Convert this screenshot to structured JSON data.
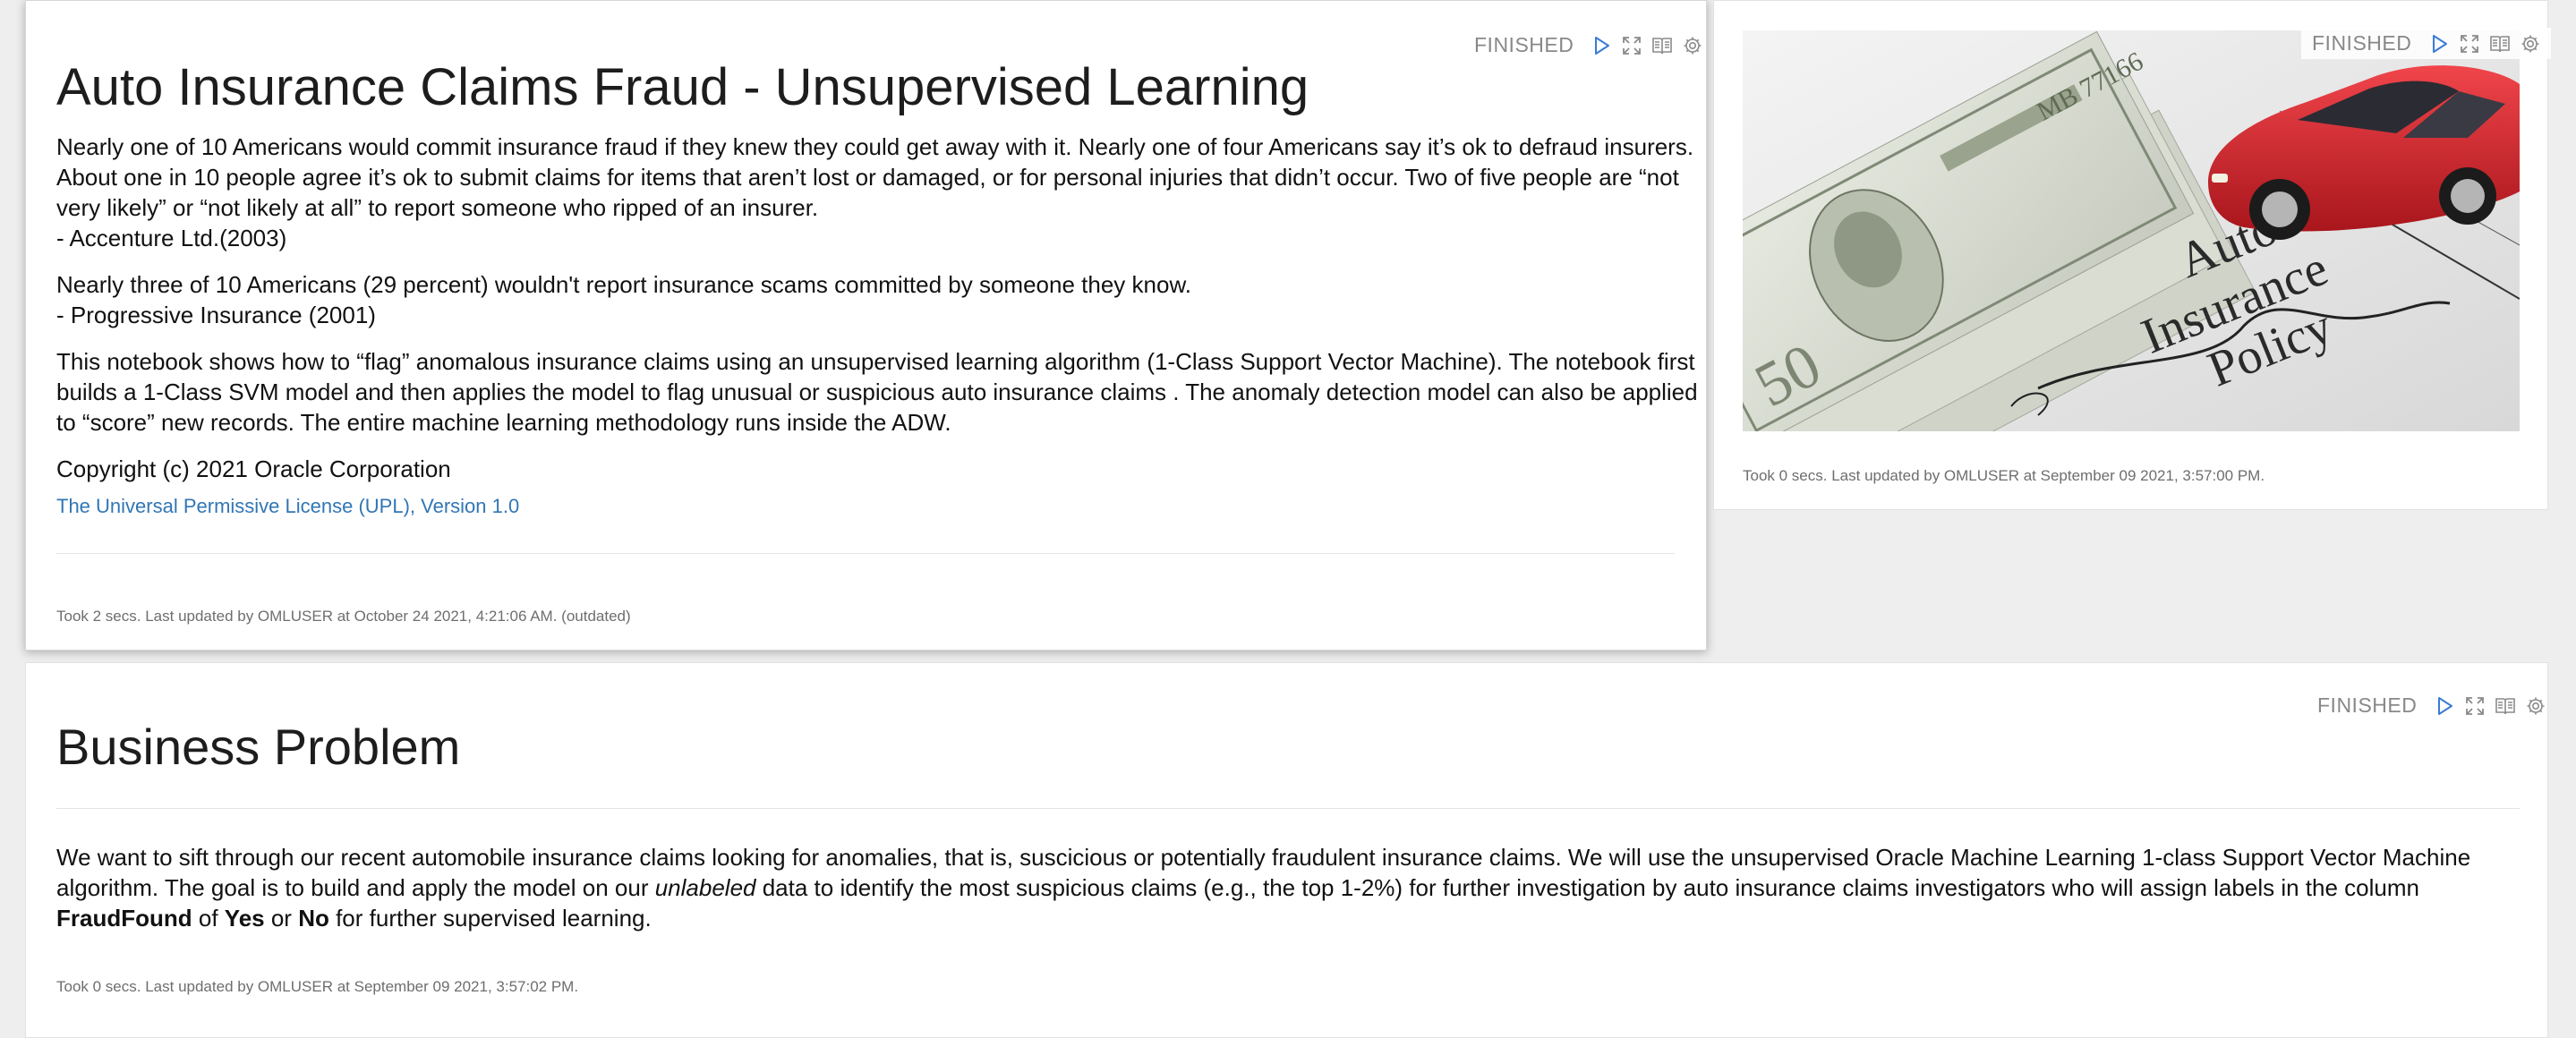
{
  "cells": [
    {
      "status": "FINISHED",
      "title": "Auto Insurance Claims Fraud - Unsupervised Learning",
      "paragraph1": "Nearly one of 10 Americans would commit insurance fraud if they knew they could get away with it. Nearly one of four Americans say it’s ok to defraud insurers. About one in 10 people agree it’s ok to submit claims for items that aren’t lost or damaged, or for personal injuries that didn’t occur. Two of five people are “not very likely” or “not likely at all” to report someone who ripped of an insurer.",
      "source1": "- Accenture Ltd.(2003)",
      "paragraph2": "Nearly three of 10 Americans (29 percent) wouldn't report insurance scams committed by someone they know.",
      "source2": "- Progressive Insurance (2001)",
      "paragraph3": "This notebook shows how to “flag” anomalous insurance claims using an unsupervised learning algorithm (1-Class Support Vector Machine). The notebook first builds a 1-Class SVM model and then applies the model to flag unusual or suspicious auto insurance claims . The anomaly detection model can also be applied to “score” new records. The entire machine learning methodology runs inside the ADW.",
      "copyright": "Copyright (c) 2021 Oracle Corporation",
      "license_link": "The Universal Permissive License (UPL), Version 1.0",
      "footer": "Took 2 secs. Last updated by OMLUSER at October 24 2021, 4:21:06 AM. (outdated)"
    },
    {
      "status": "FINISHED",
      "image_text": [
        "Auto",
        "Insurance",
        "Policy"
      ],
      "footer": "Took 0 secs. Last updated by OMLUSER at September 09 2021, 3:57:00 PM."
    },
    {
      "status": "FINISHED",
      "title": "Business Problem",
      "text_a": "We want to sift through our recent automobile insurance claims looking for anomalies, that is, suscicious or potentially fraudulent insurance claims. We will use the unsupervised Oracle Machine Learning 1-class Support Vector Machine algorithm. The goal is to build and apply the model on our ",
      "text_em": "unlabeled",
      "text_b": " data to identify the most suspicious claims (e.g., the top 1-2%) for further investigation by auto insurance claims investigators who will assign labels in the column ",
      "text_strong1": "FraudFound",
      "text_c": " of ",
      "text_strong2": "Yes",
      "text_d": " or ",
      "text_strong3": "No",
      "text_e": " for further supervised learning.",
      "footer": "Took 0 secs. Last updated by OMLUSER at September 09 2021, 3:57:02 PM."
    }
  ],
  "icons": [
    "run-icon",
    "expand-icon",
    "book-icon",
    "gear-icon"
  ],
  "colors": {
    "link": "#3176b5",
    "run_icon": "#3a7bd5",
    "car": "#d4232b"
  }
}
